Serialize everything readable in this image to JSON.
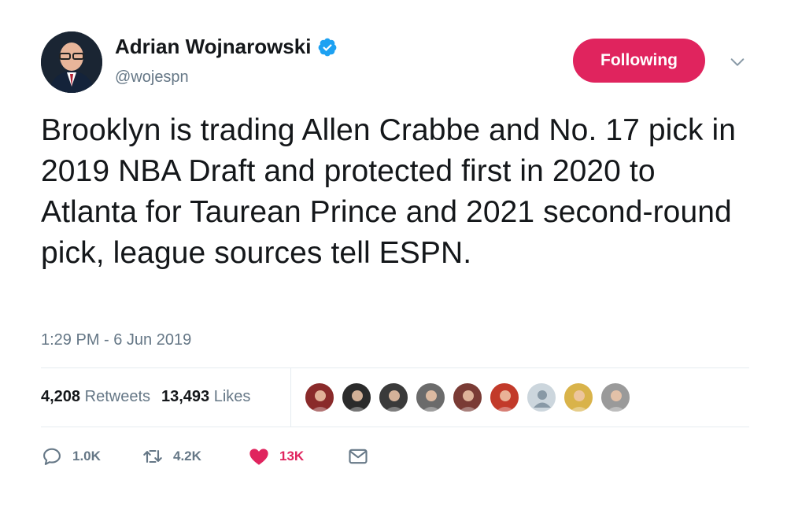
{
  "author": {
    "name": "Adrian Wojnarowski",
    "handle": "@wojespn",
    "verified": true
  },
  "follow_button_label": "Following",
  "tweet_text": "Brooklyn is trading Allen Crabbe and No. 17 pick in 2019 NBA Draft and protected first in 2020 to Atlanta for Taurean Prince and 2021 second-round pick, league sources tell ESPN.",
  "timestamp": "1:29 PM - 6 Jun 2019",
  "stats": {
    "retweets_count": "4,208",
    "retweets_label": "Retweets",
    "likes_count": "13,493",
    "likes_label": "Likes"
  },
  "liker_faces": [
    {
      "icon": "liker-avatar",
      "color": "#8a2a2a"
    },
    {
      "icon": "liker-avatar",
      "color": "#2b2b2b"
    },
    {
      "icon": "liker-avatar",
      "color": "#3a3a3a"
    },
    {
      "icon": "liker-avatar",
      "color": "#6b6b6b"
    },
    {
      "icon": "liker-avatar",
      "color": "#7a3b35"
    },
    {
      "icon": "liker-avatar",
      "color": "#c23a2a"
    },
    {
      "icon": "default-avatar",
      "color": "#ccd6dd"
    },
    {
      "icon": "liker-avatar",
      "color": "#d9b34a"
    },
    {
      "icon": "liker-avatar",
      "color": "#9a9a9a"
    }
  ],
  "actions": {
    "reply_count": "1.0K",
    "retweet_count": "4.2K",
    "like_count": "13K"
  },
  "colors": {
    "accent": "#e0245e",
    "verified": "#1da1f2",
    "muted": "#657786",
    "divider": "#e6ecf0"
  }
}
